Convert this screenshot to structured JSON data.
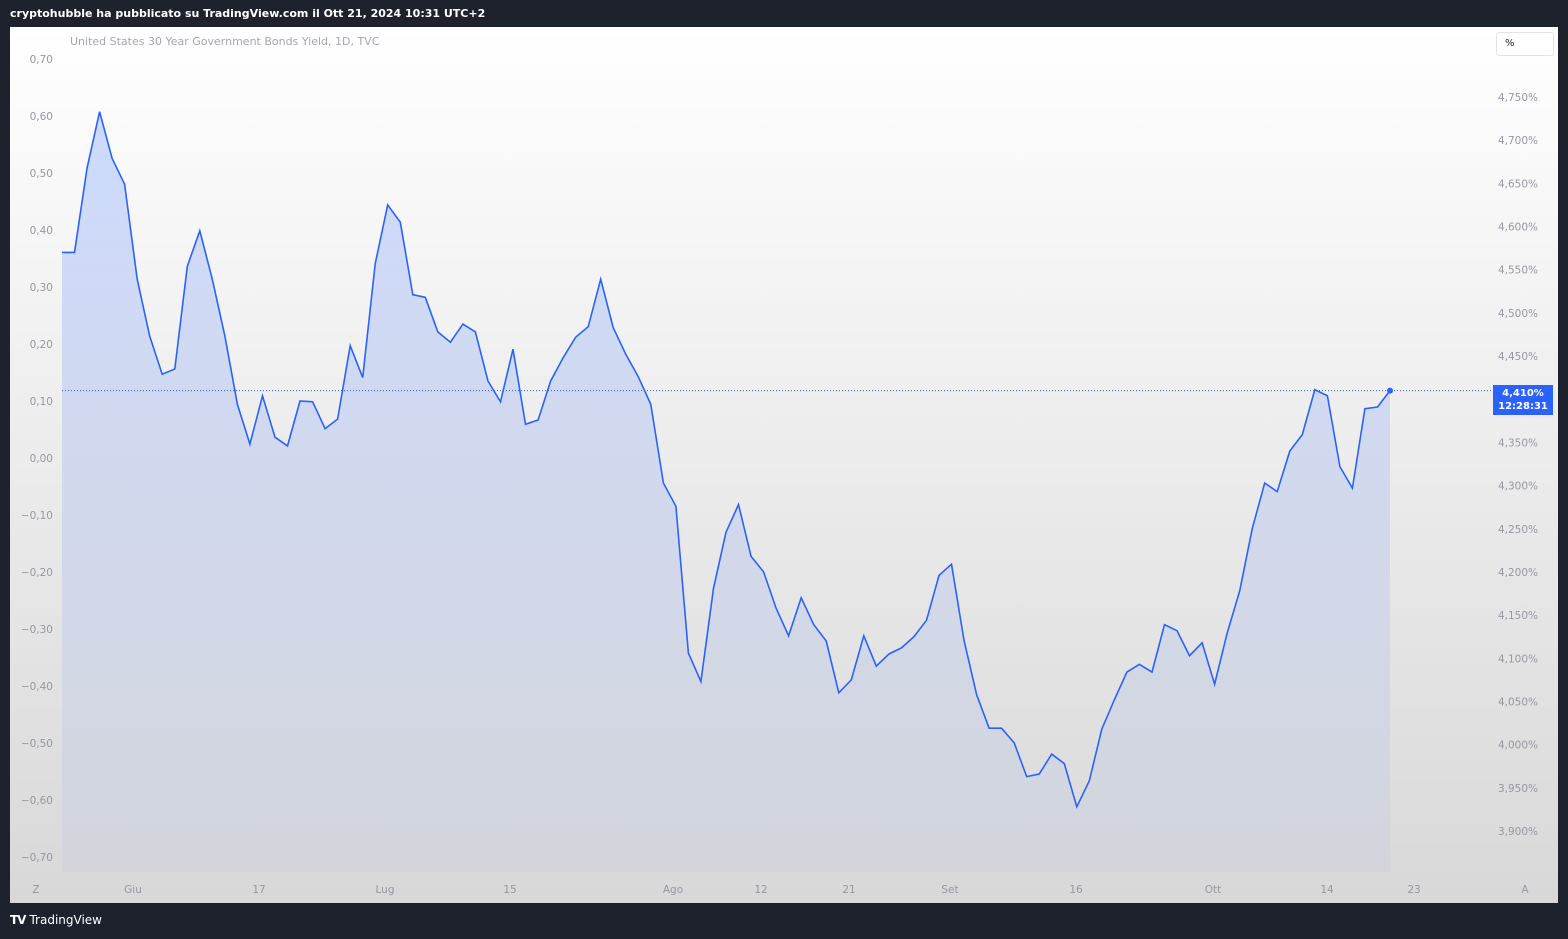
{
  "header": {
    "published": "cryptohubble ha pubblicato su TradingView.com il Ott 21, 2024 10:31 UTC+2"
  },
  "footer": {
    "brand": "TradingView",
    "logo": "TV"
  },
  "colors": {
    "line": "#2962ff",
    "background": "#1e222d"
  },
  "chart_data": {
    "type": "line",
    "title": "United States 30 Year Government Bonds Yield, 1D, TVC",
    "unit_button": "%",
    "last_value_label": "4,410%",
    "countdown": "12:28:31",
    "last_value": 4.41,
    "right_axis": {
      "ylim": [
        3.9,
        4.75
      ],
      "ticks": [
        "4,750%",
        "4,700%",
        "4,650%",
        "4,600%",
        "4,550%",
        "4,500%",
        "4,450%",
        "4,400%",
        "4,350%",
        "4,300%",
        "4,250%",
        "4,200%",
        "4,150%",
        "4,100%",
        "4,050%",
        "4,000%",
        "3,950%",
        "3,900%"
      ]
    },
    "left_axis": {
      "ticks": [
        "0,70",
        "0,60",
        "0,50",
        "0,40",
        "0,30",
        "0,20",
        "0,10",
        "0,00",
        "−0,10",
        "−0,20",
        "−0,30",
        "−0,40",
        "−0,50",
        "−0,60",
        "−0,70"
      ]
    },
    "x_ticks": [
      "Z",
      "Giu",
      "17",
      "Lug",
      "15",
      "Ago",
      "12",
      "21",
      "Set",
      "16",
      "Ott",
      "14",
      "23",
      "A"
    ],
    "values": [
      4.57,
      4.57,
      4.668,
      4.733,
      4.679,
      4.649,
      4.539,
      4.473,
      4.429,
      4.435,
      4.554,
      4.595,
      4.539,
      4.473,
      4.394,
      4.348,
      4.404,
      4.356,
      4.346,
      4.398,
      4.397,
      4.366,
      4.377,
      4.462,
      4.425,
      4.557,
      4.625,
      4.605,
      4.521,
      4.518,
      4.478,
      4.466,
      4.487,
      4.478,
      4.421,
      4.397,
      4.458,
      4.371,
      4.376,
      4.421,
      4.448,
      4.472,
      4.484,
      4.539,
      4.483,
      4.452,
      4.426,
      4.394,
      4.303,
      4.276,
      4.106,
      4.073,
      4.181,
      4.246,
      4.278,
      4.218,
      4.2,
      4.158,
      4.126,
      4.17,
      4.139,
      4.12,
      4.06,
      4.075,
      4.126,
      4.091,
      4.105,
      4.112,
      4.125,
      4.144,
      4.196,
      4.209,
      4.121,
      4.058,
      4.019,
      4.019,
      4.002,
      3.963,
      3.966,
      3.989,
      3.978,
      3.928,
      3.958,
      4.018,
      4.052,
      4.084,
      4.093,
      4.084,
      4.139,
      4.132,
      4.103,
      4.118,
      4.07,
      4.129,
      4.178,
      4.25,
      4.303,
      4.293,
      4.34,
      4.359,
      4.411,
      4.404,
      4.322,
      4.297,
      4.389,
      4.391,
      4.41
    ]
  }
}
